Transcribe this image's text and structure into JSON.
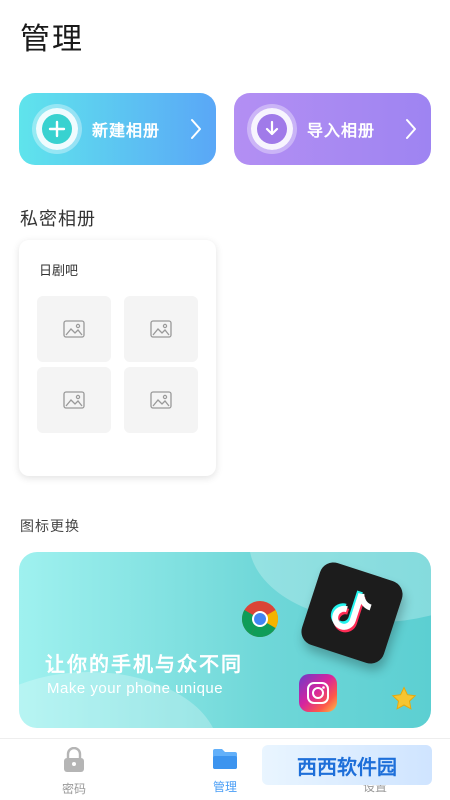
{
  "page": {
    "title": "管理"
  },
  "actions": {
    "new_album": {
      "label": "新建相册",
      "icon": "plus-circle-icon",
      "colors": [
        "#5fe4ec",
        "#5aa7f7"
      ]
    },
    "import_album": {
      "label": "导入相册",
      "icon": "download-circle-icon",
      "colors": [
        "#b38ff3",
        "#9e84f2"
      ]
    }
  },
  "private_albums": {
    "title": "私密相册",
    "albums": [
      {
        "name": "日剧吧",
        "thumbnails": [
          "image-placeholder-icon",
          "image-placeholder-icon",
          "image-placeholder-icon",
          "image-placeholder-icon"
        ]
      }
    ]
  },
  "icon_change": {
    "title": "图标更换",
    "banner": {
      "headline": "让你的手机与众不同",
      "subline": "Make your phone unique",
      "icons": [
        "chrome-icon",
        "tiktok-icon",
        "instagram-icon",
        "star-icon"
      ]
    }
  },
  "bottom_nav": {
    "items": [
      {
        "label": "密码",
        "icon": "lock-icon",
        "active": false
      },
      {
        "label": "管理",
        "icon": "folder-icon",
        "active": true
      },
      {
        "label": "设置",
        "icon": "settings-icon",
        "active": false
      }
    ],
    "accent": "#4a9ef6"
  },
  "watermark": {
    "text": "西西软件园"
  }
}
